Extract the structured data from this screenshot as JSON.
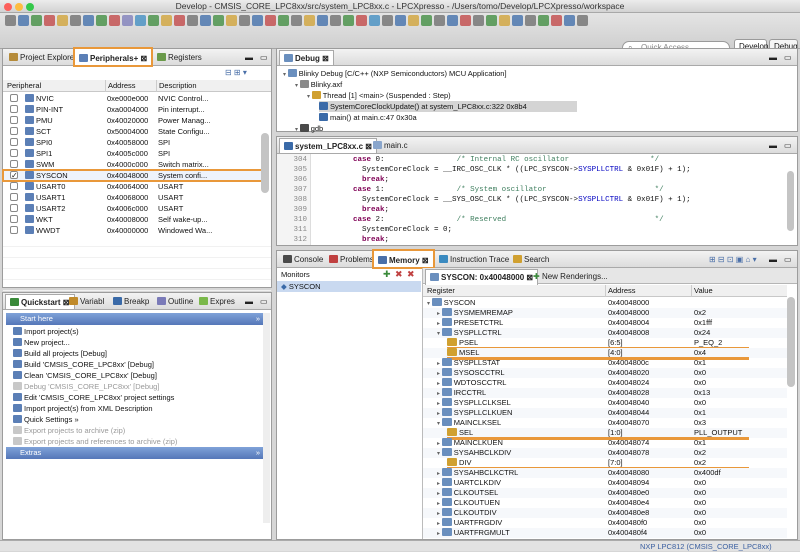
{
  "window": {
    "title": "Develop - CMSIS_CORE_LPC8xx/src/system_LPC8xx.c - LPCXpresso - /Users/tomo/Develop/LPCXpresso/workspace"
  },
  "toolbar": {
    "quick_access_placeholder": "Quick Access",
    "perspective_develop": "Develop",
    "perspective_debug": "Debug"
  },
  "peripherals_panel": {
    "tabs": [
      "Project Explorer",
      "Peripherals+",
      "Registers"
    ],
    "columns": [
      "Peripheral",
      "Address",
      "Description"
    ],
    "rows": [
      {
        "checked": false,
        "name": "NVIC",
        "address": "0xe000e000",
        "description": "NVIC Control..."
      },
      {
        "checked": false,
        "name": "PIN-INT",
        "address": "0xa0004000",
        "description": "Pin interrupt..."
      },
      {
        "checked": false,
        "name": "PMU",
        "address": "0x40020000",
        "description": "Power Manag..."
      },
      {
        "checked": false,
        "name": "SCT",
        "address": "0x50004000",
        "description": "State Configu..."
      },
      {
        "checked": false,
        "name": "SPI0",
        "address": "0x40058000",
        "description": "SPI"
      },
      {
        "checked": false,
        "name": "SPI1",
        "address": "0x4005c000",
        "description": "SPI"
      },
      {
        "checked": false,
        "name": "SWM",
        "address": "0x4000c000",
        "description": "Switch matrix..."
      },
      {
        "checked": true,
        "name": "SYSCON",
        "address": "0x40048000",
        "description": "System confi..."
      },
      {
        "checked": false,
        "name": "USART0",
        "address": "0x40064000",
        "description": "USART"
      },
      {
        "checked": false,
        "name": "USART1",
        "address": "0x40068000",
        "description": "USART"
      },
      {
        "checked": false,
        "name": "USART2",
        "address": "0x4006c000",
        "description": "USART"
      },
      {
        "checked": false,
        "name": "WKT",
        "address": "0x40008000",
        "description": "Self wake-up..."
      },
      {
        "checked": false,
        "name": "WWDT",
        "address": "0x40000000",
        "description": "Windowed Wa..."
      }
    ]
  },
  "debug_panel": {
    "tab": "Debug",
    "tree": [
      {
        "depth": 0,
        "text": "Blinky Debug [C/C++ (NXP Semiconductors) MCU Application]"
      },
      {
        "depth": 1,
        "text": "Blinky.axf"
      },
      {
        "depth": 2,
        "text": "Thread [1] <main> (Suspended : Step)"
      },
      {
        "depth": 3,
        "text": "SystemCoreClockUpdate() at system_LPC8xx.c:322 0x8b4",
        "selected": true
      },
      {
        "depth": 3,
        "text": "main() at main.c:47 0x30a"
      },
      {
        "depth": 1,
        "text": "gdb"
      }
    ]
  },
  "editor": {
    "tabs": [
      "system_LPC8xx.c",
      "main.c"
    ],
    "lines": [
      {
        "n": "304",
        "indent": "        ",
        "kw": "case",
        "rest": " 0:",
        "comment": "/* Internal RC oscillator                  */"
      },
      {
        "n": "305",
        "indent": "          ",
        "pre": "SystemCoreClock = __IRC_OSC_CLK * ((LPC_SYSCON->",
        "field": "SYSPLLCTRL",
        "post": " & 0x01F) + 1);"
      },
      {
        "n": "306",
        "indent": "          ",
        "kw": "break",
        "rest": ";"
      },
      {
        "n": "307",
        "indent": "        ",
        "kw": "case",
        "rest": " 1:",
        "comment": "/* System oscillator                        */"
      },
      {
        "n": "308",
        "indent": "          ",
        "pre": "SystemCoreClock = __SYS_OSC_CLK * ((LPC_SYSCON->",
        "field": "SYSPLLCTRL",
        "post": " & 0x01F) + 1);"
      },
      {
        "n": "309",
        "indent": "          ",
        "kw": "break",
        "rest": ";"
      },
      {
        "n": "310",
        "indent": "        ",
        "kw": "case",
        "rest": " 2:",
        "comment": "/* Reserved                                 */"
      },
      {
        "n": "311",
        "indent": "          ",
        "pre": "SystemCoreClock = 0;"
      },
      {
        "n": "312",
        "indent": "          ",
        "kw": "break",
        "rest": ";"
      }
    ]
  },
  "quickstart": {
    "tabs": [
      "Quickstart",
      "Variabl",
      "Breakp",
      "Outline",
      "Expres"
    ],
    "sections": [
      {
        "type": "section",
        "text": "Start here"
      },
      {
        "type": "item",
        "text": "Import project(s)",
        "enabled": true
      },
      {
        "type": "item",
        "text": "New project...",
        "enabled": true
      },
      {
        "type": "item",
        "text": "Build all projects [Debug]",
        "enabled": true
      },
      {
        "type": "item",
        "text": "Build 'CMSIS_CORE_LPC8xx' [Debug]",
        "enabled": true
      },
      {
        "type": "item",
        "text": "Clean 'CMSIS_CORE_LPC8xx' [Debug]",
        "enabled": true
      },
      {
        "type": "item",
        "text": "Debug 'CMSIS_CORE_LPC8xx' [Debug]",
        "enabled": false
      },
      {
        "type": "item",
        "text": "Edit 'CMSIS_CORE_LPC8xx' project settings",
        "enabled": true
      },
      {
        "type": "item",
        "text": "Import project(s) from XML Description",
        "enabled": true
      },
      {
        "type": "item",
        "text": "Quick Settings »",
        "enabled": true
      },
      {
        "type": "item",
        "text": "Export projects to archive (zip)",
        "enabled": false
      },
      {
        "type": "item",
        "text": "Export projects and references to archive (zip)",
        "enabled": false
      },
      {
        "type": "section",
        "text": "Extras"
      }
    ]
  },
  "memory_panel": {
    "tabs": [
      "Console",
      "Problems",
      "Memory",
      "Instruction Trace",
      "Search"
    ],
    "monitors_label": "Monitors",
    "monitor_item": "SYSCON",
    "render_tab": "SYSCON: 0x40048000",
    "new_renderings": "New Renderings...",
    "columns": [
      "Register",
      "Address",
      "Value"
    ],
    "rows": [
      {
        "d": 0,
        "name": "SYSCON",
        "addr": "0x40048000",
        "val": ""
      },
      {
        "d": 1,
        "name": "SYSMEMREMAP",
        "addr": "0x40048000",
        "val": "0x2"
      },
      {
        "d": 1,
        "name": "PRESETCTRL",
        "addr": "0x40048004",
        "val": "0x1fff"
      },
      {
        "d": 1,
        "name": "SYSPLLCTRL",
        "addr": "0x40048008",
        "val": "0x24"
      },
      {
        "d": 2,
        "name": "PSEL",
        "addr": "[6:5]",
        "val": "P_EQ_2",
        "field": true
      },
      {
        "d": 2,
        "name": "MSEL",
        "addr": "[4:0]",
        "val": "0x4",
        "field": true
      },
      {
        "d": 1,
        "name": "SYSPLLSTAT",
        "addr": "0x4004800c",
        "val": "0x1"
      },
      {
        "d": 1,
        "name": "SYSOSCCTRL",
        "addr": "0x40048020",
        "val": "0x0"
      },
      {
        "d": 1,
        "name": "WDTOSCCTRL",
        "addr": "0x40048024",
        "val": "0x0"
      },
      {
        "d": 1,
        "name": "IRCCTRL",
        "addr": "0x40048028",
        "val": "0x13"
      },
      {
        "d": 1,
        "name": "SYSPLLCLKSEL",
        "addr": "0x40048040",
        "val": "0x0"
      },
      {
        "d": 1,
        "name": "SYSPLLCLKUEN",
        "addr": "0x40048044",
        "val": "0x1"
      },
      {
        "d": 1,
        "name": "MAINCLKSEL",
        "addr": "0x40048070",
        "val": "0x3"
      },
      {
        "d": 2,
        "name": "SEL",
        "addr": "[1:0]",
        "val": "PLL_OUTPUT",
        "field": true
      },
      {
        "d": 1,
        "name": "MAINCLKUEN",
        "addr": "0x40048074",
        "val": "0x1"
      },
      {
        "d": 1,
        "name": "SYSAHBCLKDIV",
        "addr": "0x40048078",
        "val": "0x2"
      },
      {
        "d": 2,
        "name": "DIV",
        "addr": "[7:0]",
        "val": "0x2",
        "field": true
      },
      {
        "d": 1,
        "name": "SYSAHBCLKCTRL",
        "addr": "0x40048080",
        "val": "0x400df"
      },
      {
        "d": 1,
        "name": "UARTCLKDIV",
        "addr": "0x40048094",
        "val": "0x0"
      },
      {
        "d": 1,
        "name": "CLKOUTSEL",
        "addr": "0x400480e0",
        "val": "0x0"
      },
      {
        "d": 1,
        "name": "CLKOUTUEN",
        "addr": "0x400480e4",
        "val": "0x0"
      },
      {
        "d": 1,
        "name": "CLKOUTDIV",
        "addr": "0x400480e8",
        "val": "0x0"
      },
      {
        "d": 1,
        "name": "UARTFRGDIV",
        "addr": "0x400480f0",
        "val": "0x0"
      },
      {
        "d": 1,
        "name": "UARTFRGMULT",
        "addr": "0x400480f4",
        "val": "0x0"
      }
    ]
  },
  "status": {
    "right": "NXP LPC812 (CMSIS_CORE_LPC8xx)"
  },
  "colors": {
    "highlight": "#e9983a",
    "selection": "#c9d9f0",
    "section": "#5577b8"
  }
}
